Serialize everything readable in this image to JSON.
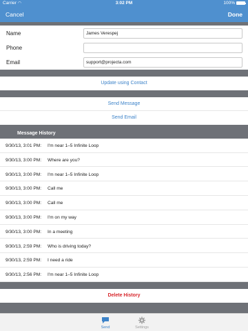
{
  "status_bar": {
    "carrier": "Carrier",
    "time": "3:02 PM",
    "battery_label": "100%",
    "battery_level": 1.0
  },
  "nav": {
    "cancel": "Cancel",
    "done": "Done"
  },
  "form": {
    "name_label": "Name",
    "name_value": "James Verespej",
    "phone_label": "Phone",
    "phone_value": "",
    "email_label": "Email",
    "email_value": "support@projecta.com"
  },
  "actions": {
    "update_contact": "Update using Contact",
    "send_message": "Send Message",
    "send_email": "Send Email",
    "delete_history": "Delete History"
  },
  "history": {
    "title": "Message History",
    "items": [
      {
        "stamp": "9/30/13, 3:01 PM:",
        "msg": "I'm near 1–5 Infinite Loop"
      },
      {
        "stamp": "9/30/13, 3:00 PM:",
        "msg": "Where are you?"
      },
      {
        "stamp": "9/30/13, 3:00 PM:",
        "msg": "I'm near 1–5 Infinite Loop"
      },
      {
        "stamp": "9/30/13, 3:00 PM:",
        "msg": "Call me"
      },
      {
        "stamp": "9/30/13, 3:00 PM:",
        "msg": "Call me"
      },
      {
        "stamp": "9/30/13, 3:00 PM:",
        "msg": "I'm on my way"
      },
      {
        "stamp": "9/30/13, 3:00 PM:",
        "msg": "In a meeting"
      },
      {
        "stamp": "9/30/13, 2:59 PM:",
        "msg": "Who is driving today?"
      },
      {
        "stamp": "9/30/13, 2:59 PM:",
        "msg": "I need a ride"
      },
      {
        "stamp": "9/30/13, 2:56 PM:",
        "msg": "I'm near 1–5 Infinite Loop"
      }
    ]
  },
  "tabs": {
    "send": "Send",
    "settings": "Settings",
    "active": "send"
  },
  "colors": {
    "accent": "#3d83c9",
    "bar": "#4f90cf",
    "separator": "#6e7177",
    "destructive": "#d7262b"
  }
}
